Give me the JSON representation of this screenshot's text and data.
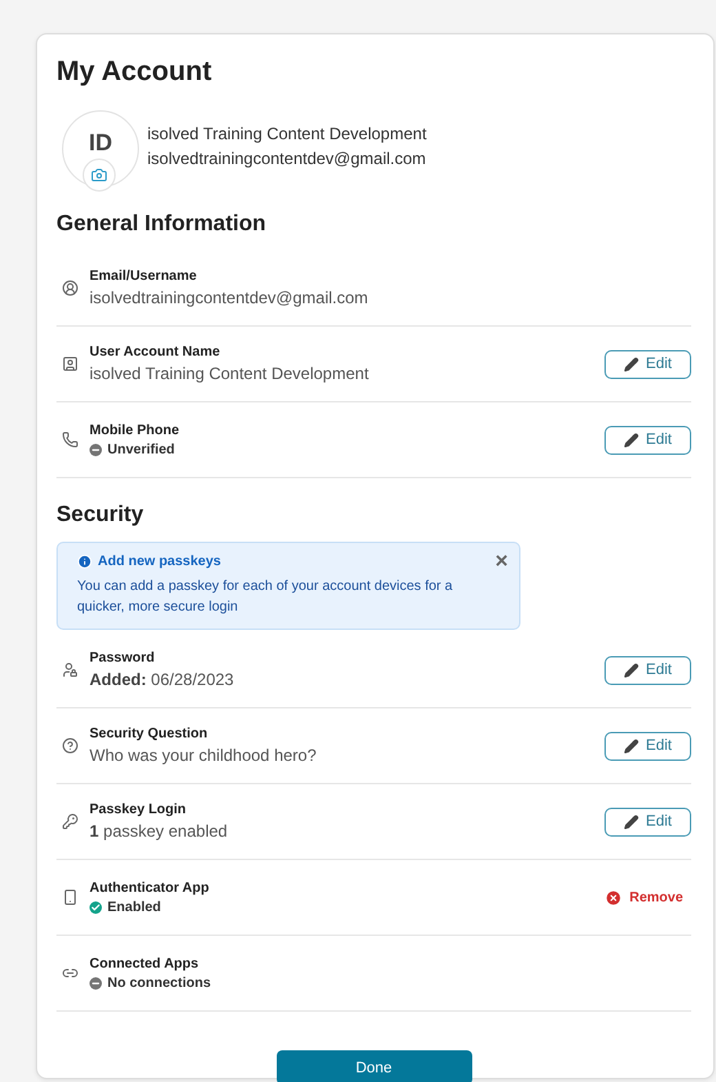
{
  "title": "My Account",
  "profile": {
    "initials": "ID",
    "name": "isolved Training Content Development",
    "email": "isolvedtrainingcontentdev@gmail.com"
  },
  "sections": [
    {
      "heading": "General Information",
      "rows": [
        {
          "label": "Email/Username",
          "value": {
            "kind": "text",
            "text": "isolvedtrainingcontentdev@gmail.com"
          }
        },
        {
          "label": "User Account Name",
          "value": {
            "kind": "text",
            "text": "isolved Training Content Development"
          },
          "action": {
            "kind": "edit",
            "label": "Edit"
          }
        },
        {
          "label": "Mobile Phone",
          "value": {
            "kind": "status",
            "text": "Unverified",
            "color": "#757575"
          },
          "action": {
            "kind": "edit",
            "label": "Edit"
          }
        }
      ]
    },
    {
      "heading": "Security",
      "banner": {
        "title": "Add new passkeys",
        "text": "You can add a passkey for each of your account devices for a quicker, more secure login",
        "close": "×"
      },
      "rows": [
        {
          "label": "Password",
          "value": {
            "kind": "text",
            "text": "**Added:** 06/28/2023"
          },
          "action": {
            "kind": "edit",
            "label": "Edit"
          }
        },
        {
          "label": "Security Question",
          "value": {
            "kind": "text",
            "text": "Who was your childhood hero?"
          },
          "action": {
            "kind": "edit",
            "label": "Edit"
          }
        },
        {
          "label": "Passkey Login",
          "value": {
            "kind": "text",
            "text": "**1** passkey enabled"
          },
          "action": {
            "kind": "edit",
            "label": "Edit"
          }
        },
        {
          "label": "Authenticator App",
          "value": {
            "kind": "status",
            "text": "Enabled",
            "color": "#14a38b"
          },
          "action": {
            "kind": "remove",
            "label": "Remove"
          }
        },
        {
          "label": "Connected Apps",
          "value": {
            "kind": "status",
            "text": "No connections",
            "color": "#757575"
          }
        }
      ]
    }
  ],
  "done": "Done"
}
